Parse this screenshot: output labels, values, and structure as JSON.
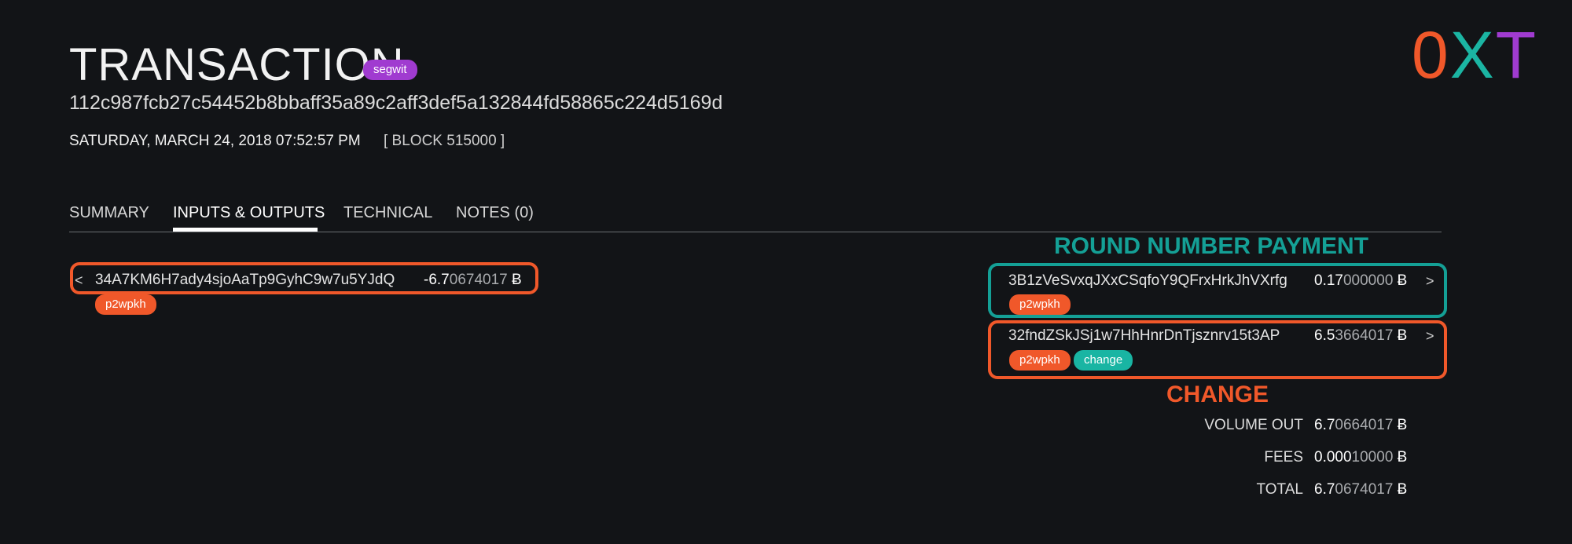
{
  "header": {
    "title": "TRANSACTION",
    "type_badge": "segwit",
    "txid": "112c987fcb27c54452b8bbaff35a89c2aff3def5a132844fd58865c224d5169d",
    "datetime": "SATURDAY, MARCH 24, 2018 07:52:57 PM",
    "block": "[ BLOCK 515000 ]"
  },
  "logo": {
    "letters": [
      "0",
      "X",
      "T"
    ],
    "colors": [
      "#f0582a",
      "#1bb5a3",
      "#a03bd0"
    ]
  },
  "tabs": [
    {
      "label": "SUMMARY",
      "active": false
    },
    {
      "label": "INPUTS & OUTPUTS",
      "active": true
    },
    {
      "label": "TECHNICAL",
      "active": false
    },
    {
      "label": "NOTES (0)",
      "active": false
    }
  ],
  "inputs": [
    {
      "prev_icon": "<",
      "address": "34A7KM6H7ady4sjoAaTp9GyhC9w7u5YJdQ",
      "amount_strong": "-6.7",
      "amount_faint": "0674017",
      "unit": "Ƀ",
      "tags": [
        "p2wpkh"
      ]
    }
  ],
  "outputs": [
    {
      "address": "3B1zVeSvxqJXxCSqfoY9QFrxHrkJhVXrfg",
      "amount_strong": "0.17",
      "amount_faint": "000000",
      "unit": "Ƀ",
      "next_icon": ">",
      "tags": [
        "p2wpkh"
      ]
    },
    {
      "address": "32fndZSkJSj1w7HhHnrDnTjsznrv15t3AP",
      "amount_strong": "6.5",
      "amount_faint": "3664017",
      "unit": "Ƀ",
      "next_icon": ">",
      "tags": [
        "p2wpkh",
        "change"
      ]
    }
  ],
  "annotations": {
    "round_payment": "ROUND NUMBER PAYMENT",
    "change": "CHANGE"
  },
  "summary": [
    {
      "label": "VOLUME OUT",
      "value_strong": "6.7",
      "value_faint": "0664017",
      "unit": "Ƀ"
    },
    {
      "label": "FEES",
      "value_strong": "0.000",
      "value_faint": "10000",
      "unit": "Ƀ"
    },
    {
      "label": "TOTAL",
      "value_strong": "6.7",
      "value_faint": "0674017",
      "unit": "Ƀ"
    }
  ],
  "colors": {
    "background": "#121417",
    "orange": "#f0582a",
    "teal": "#1bb5a3",
    "purple": "#a03bd0"
  }
}
